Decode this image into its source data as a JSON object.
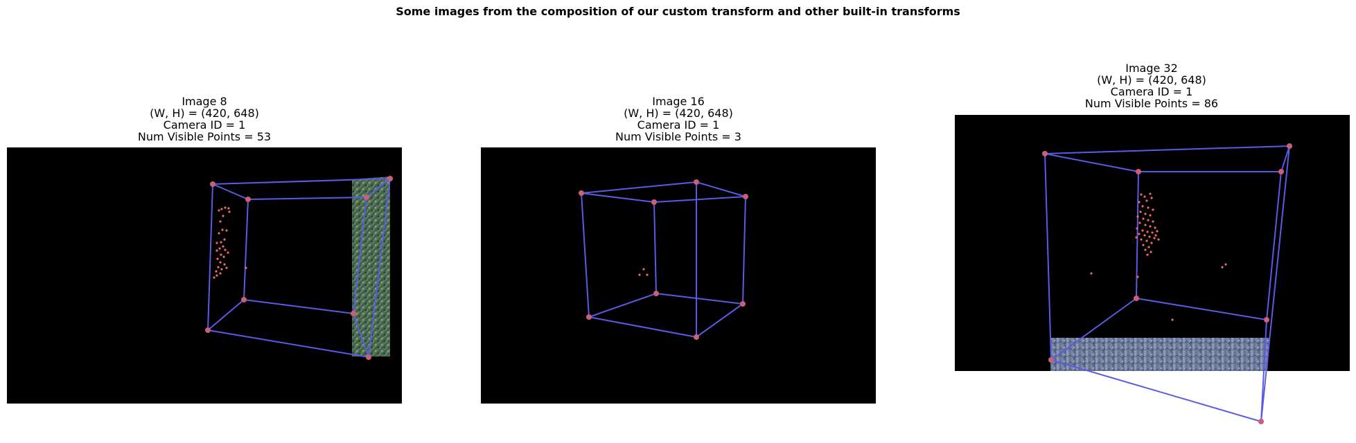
{
  "figure": {
    "suptitle": "Some images from the composition of our custom transform and other built-in transforms",
    "colors": {
      "edge": "#5b5be6",
      "vertex": "#c8607a",
      "point": "#f06a6a",
      "background": "#000000"
    }
  },
  "panels": [
    {
      "title_line1": "Image 8",
      "title_line2": "(W, H) = (420, 648)",
      "title_line3": "Camera ID = 1",
      "title_line4": "Num Visible Points = 53"
    },
    {
      "title_line1": "Image 16",
      "title_line2": "(W, H) = (420, 648)",
      "title_line3": "Camera ID = 1",
      "title_line4": "Num Visible Points = 3"
    },
    {
      "title_line1": "Image 32",
      "title_line2": "(W, H) = (420, 648)",
      "title_line3": "Camera ID = 1",
      "title_line4": "Num Visible Points = 86"
    }
  ]
}
